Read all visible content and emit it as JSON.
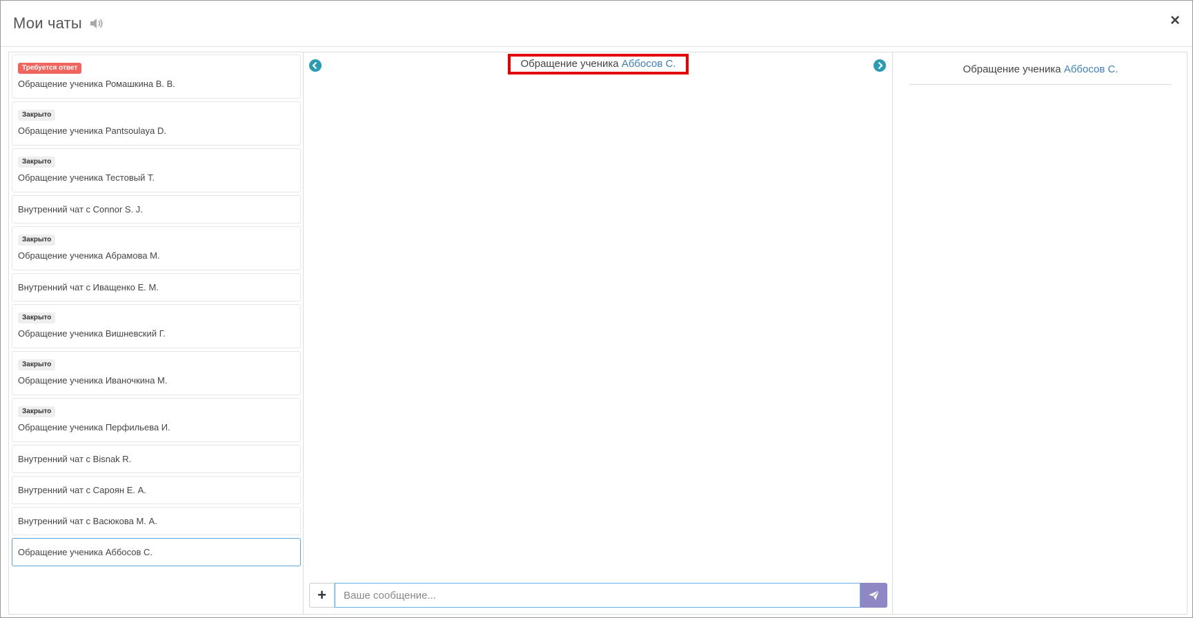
{
  "modal": {
    "title": "Мои чаты",
    "close_label": "×"
  },
  "chats": [
    {
      "badge": "Требуется ответ",
      "badge_type": "red",
      "title": "Обращение ученика Ромашкина В. В."
    },
    {
      "badge": "Закрыто",
      "badge_type": "gray",
      "title": "Обращение ученика Pantsoulaya D."
    },
    {
      "badge": "Закрыто",
      "badge_type": "gray",
      "title": "Обращение ученика Тестовый Т."
    },
    {
      "badge": "",
      "badge_type": "",
      "title": "Внутренний чат с Connor S. J."
    },
    {
      "badge": "Закрыто",
      "badge_type": "gray",
      "title": "Обращение ученика Абрамова М."
    },
    {
      "badge": "",
      "badge_type": "",
      "title": "Внутренний чат с Иващенко Е. М."
    },
    {
      "badge": "Закрыто",
      "badge_type": "gray",
      "title": "Обращение ученика Вишневский Г."
    },
    {
      "badge": "Закрыто",
      "badge_type": "gray",
      "title": "Обращение ученика Иваночкина М."
    },
    {
      "badge": "Закрыто",
      "badge_type": "gray",
      "title": "Обращение ученика Перфильева И."
    },
    {
      "badge": "",
      "badge_type": "",
      "title": "Внутренний чат с Bisnak R."
    },
    {
      "badge": "",
      "badge_type": "",
      "title": "Внутренний чат с Сароян Е. А."
    },
    {
      "badge": "",
      "badge_type": "",
      "title": "Внутренний чат с Васюкова М. А."
    },
    {
      "badge": "",
      "badge_type": "",
      "title": "Обращение ученика Аббосов С.",
      "active": true
    }
  ],
  "center": {
    "title_prefix": "Обращение ученика",
    "title_name": "Аббосов С.",
    "placeholder": "Ваше сообщение...",
    "plus_label": "+"
  },
  "right": {
    "title_prefix": "Обращение ученика",
    "title_name": "Аббосов С."
  },
  "colors": {
    "accent": "#2a9bb5",
    "link": "#3d7fc0",
    "highlight_border": "#e50000",
    "send_button": "#8f86c4",
    "badge_red": "#f0665e"
  }
}
